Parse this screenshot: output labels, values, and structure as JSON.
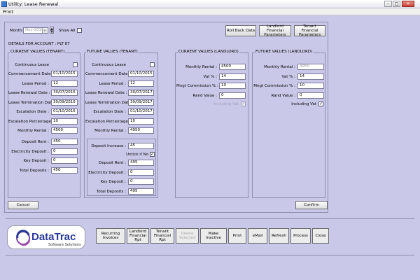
{
  "window": {
    "title": "Utility: Lease Renewal",
    "minimize": "–",
    "maximize": "□",
    "close": "✕"
  },
  "menu": {
    "print": "Print"
  },
  "top": {
    "month_label": "Month:",
    "month_value": "Nov-2016",
    "show_all_label": "Show All",
    "rollback_btn": "Roll Back Data",
    "landlord_fin_btn": "Landlord Financial Parameters",
    "tenant_fin_btn": "Tenant Financial Parameters"
  },
  "details_label": "DETAILS FOR ACCOUNT : PLT 87",
  "current_tenant": {
    "title": "CURRENT VALUES (TENANT)",
    "continuous_lease": "Continuous Lease",
    "fields": [
      {
        "label": "Commencement Date :",
        "value": "01/10/2015"
      },
      {
        "label": "Lease Period :",
        "value": "12"
      },
      {
        "label": "Lease Renewal Date :",
        "value": "30/07/2016"
      },
      {
        "label": "Lease Termination Date :",
        "value": "30/09/2016"
      },
      {
        "label": "Escalation Date :",
        "value": "01/10/2016"
      },
      {
        "label": "Escalation Percentage :",
        "value": "10"
      },
      {
        "label": "Monthly Rental :",
        "value": "4500"
      }
    ],
    "deposits": [
      {
        "label": "Deposit Rent :",
        "value": "450"
      },
      {
        "label": "Electricity Deposit :",
        "value": "0"
      },
      {
        "label": "Key Deposit :",
        "value": "0"
      },
      {
        "label": "Total Deposits :",
        "value": "450"
      }
    ]
  },
  "future_tenant": {
    "title": "FUTURE VALUES (TENANT)",
    "continuous_lease": "Continuous Lease",
    "fields": [
      {
        "label": "Commencement Date :",
        "value": "01/10/2015"
      },
      {
        "label": "Lease Period :",
        "value": "12"
      },
      {
        "label": "Lease Renewal Date :",
        "value": "30/07/2017"
      },
      {
        "label": "Lease Termination Date :",
        "value": "30/09/2017"
      },
      {
        "label": "Escalation Date :",
        "value": "01/10/2017"
      },
      {
        "label": "Escalation Percentage :",
        "value": "10"
      },
      {
        "label": "Monthly Rental :",
        "value": "4950"
      }
    ],
    "deposit_increase_label": "Deposit Increase :",
    "deposit_increase_value": "45",
    "untick_label": "Untick if No",
    "deposits": [
      {
        "label": "Deposit Rent :",
        "value": "495"
      },
      {
        "label": "Electricity Deposit :",
        "value": "0"
      },
      {
        "label": "Key Deposit :",
        "value": "0"
      },
      {
        "label": "Total Deposits :",
        "value": "495"
      }
    ]
  },
  "current_landlord": {
    "title": "CURRENT VALUES (LANDLORD)",
    "fields": [
      {
        "label": "Monthly Rental :",
        "value": "4500"
      },
      {
        "label": "Vat % :",
        "value": "14"
      },
      {
        "label": "Mngt Commission % :",
        "value": "10"
      },
      {
        "label": "Rand Value :",
        "value": "0"
      }
    ],
    "including_vat": "Including Vat"
  },
  "future_landlord": {
    "title": "FUTURE VALUES (LANDLORD)",
    "fields": [
      {
        "label": "Monthly Rental :",
        "value": "4950"
      },
      {
        "label": "Vat % :",
        "value": "14"
      },
      {
        "label": "Mngt Commission % :",
        "value": "10"
      },
      {
        "label": "Rand Value :",
        "value": "0"
      }
    ],
    "including_vat": "Including Vat"
  },
  "actions": {
    "cancel": "Cancel",
    "confirm": "Confirm"
  },
  "logo": {
    "name": "DataTrac",
    "tagline": "Software Solutions"
  },
  "bottom_buttons": [
    {
      "label": "Recurring Invoices",
      "disabled": false
    },
    {
      "label": "Landlord Financial Rpt",
      "disabled": false
    },
    {
      "label": "Tenant Financial Rpt",
      "disabled": false
    },
    {
      "label": "Delete Selected",
      "disabled": true
    },
    {
      "label": "Make Inactive",
      "disabled": false
    },
    {
      "label": "Print",
      "disabled": false
    },
    {
      "label": "eMail",
      "disabled": false
    },
    {
      "label": "Refresh",
      "disabled": false
    },
    {
      "label": "Process",
      "disabled": false
    },
    {
      "label": "Close",
      "disabled": false
    }
  ],
  "colors": {
    "background": "#c9c8e8",
    "logo_blue": "#2a3a9a",
    "logo_purple": "#7a4aa8"
  }
}
